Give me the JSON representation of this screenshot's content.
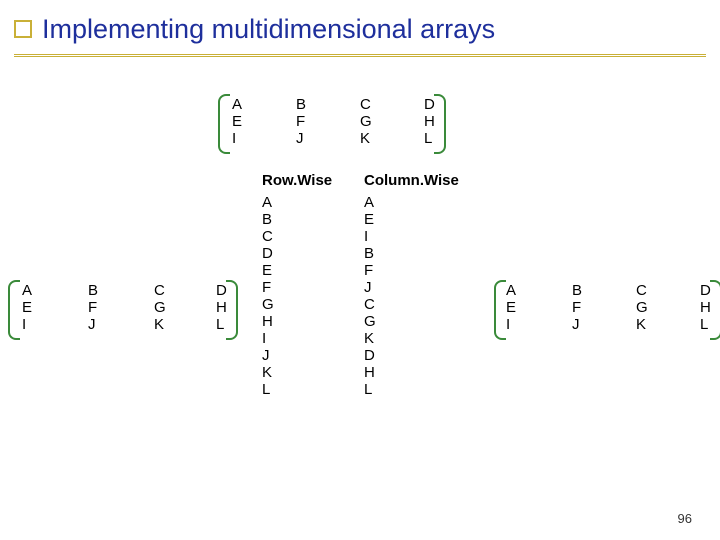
{
  "title": "Implementing multidimensional arrays",
  "page_number": "96",
  "top_matrix": {
    "cols": [
      [
        "A",
        "E",
        "I"
      ],
      [
        "B",
        "F",
        "J"
      ],
      [
        "C",
        "G",
        "K"
      ],
      [
        "D",
        "H",
        "L"
      ]
    ]
  },
  "left_matrix": {
    "cols": [
      [
        "A",
        "E",
        "I"
      ],
      [
        "B",
        "F",
        "J"
      ],
      [
        "C",
        "G",
        "K"
      ],
      [
        "D",
        "H",
        "L"
      ]
    ]
  },
  "right_matrix": {
    "cols": [
      [
        "A",
        "E",
        "I"
      ],
      [
        "B",
        "F",
        "J"
      ],
      [
        "C",
        "G",
        "K"
      ],
      [
        "D",
        "H",
        "L"
      ]
    ]
  },
  "lists": {
    "rowwise": {
      "header": "Row.Wise",
      "items": [
        "A",
        "B",
        "C",
        "D",
        "E",
        "F",
        "G",
        "H",
        "I",
        "J",
        "K",
        "L"
      ]
    },
    "colwise": {
      "header": "Column.Wise",
      "items": [
        "A",
        "E",
        "I",
        "B",
        "F",
        "J",
        "C",
        "G",
        "K",
        "D",
        "H",
        "L"
      ]
    }
  }
}
